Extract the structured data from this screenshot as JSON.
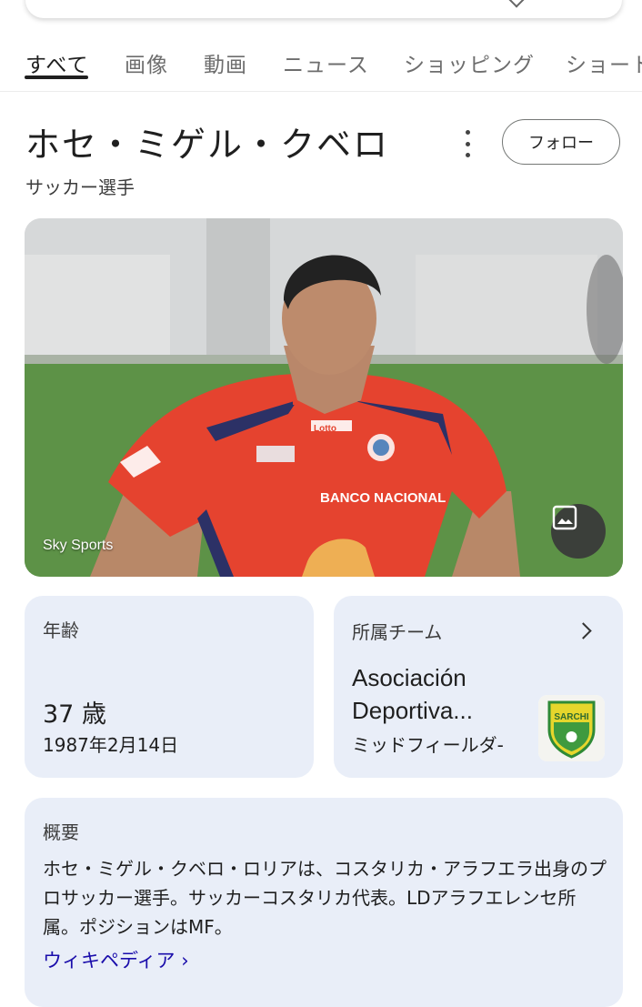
{
  "tabs": [
    {
      "label": "すべて",
      "active": true
    },
    {
      "label": "画像"
    },
    {
      "label": "動画"
    },
    {
      "label": "ニュース"
    },
    {
      "label": "ショッピング"
    },
    {
      "label": "ショート"
    }
  ],
  "entity": {
    "name": "ホセ・ミゲル・クベロ",
    "type": "サッカー選手",
    "follow_label": "フォロー",
    "more_icon": "more-vert-icon"
  },
  "photo": {
    "source": "Sky Sports",
    "image_button_icon": "image-icon",
    "jersey_text": "BANCO NACIONAL",
    "jersey_brand": "Lotto"
  },
  "age_card": {
    "label": "年齢",
    "value": "37 歳",
    "birthdate": "1987年2月14日"
  },
  "team_card": {
    "label": "所属チーム",
    "name": "Asociación Deportiva...",
    "position": "ミッドフィールダ-",
    "logo_text": "SARCHI",
    "chevron_icon": "chevron-right-icon"
  },
  "overview": {
    "label": "概要",
    "text": "ホセ・ミゲル・クベロ・ロリアは、コスタリカ・アラフエラ出身のプロサッカー選手。サッカーコスタリカ代表。LDアラフエレンセ所属。ポジションはMF。",
    "source_link": "ウィキペディア ›"
  },
  "colors": {
    "card_bg": "#e9eef8",
    "link": "#1a0dab",
    "jersey": "#e5432f"
  }
}
